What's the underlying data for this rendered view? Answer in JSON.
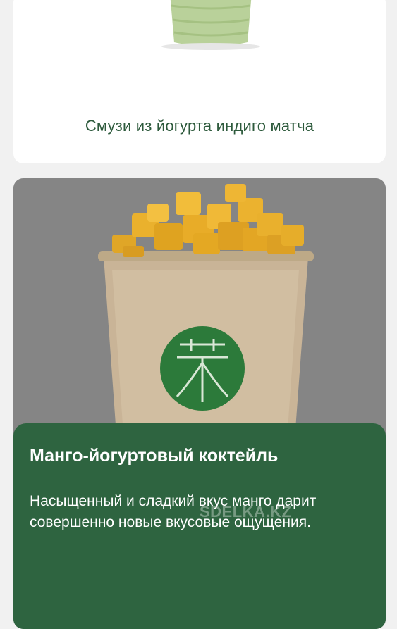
{
  "top_card": {
    "title": "Смузи из йогурта индиго матча"
  },
  "main_card": {
    "title": "Манго-йогуртовый коктейль",
    "description": "Насыщенный и сладкий вкус манго дарит совершенно новые вкусовые ощущения."
  },
  "watermark": "SDELKA.KZ",
  "colors": {
    "accent_green": "#2e6440",
    "title_green": "#2d5a3c",
    "card_background": "#ffffff",
    "image_overlay": "#858585"
  }
}
